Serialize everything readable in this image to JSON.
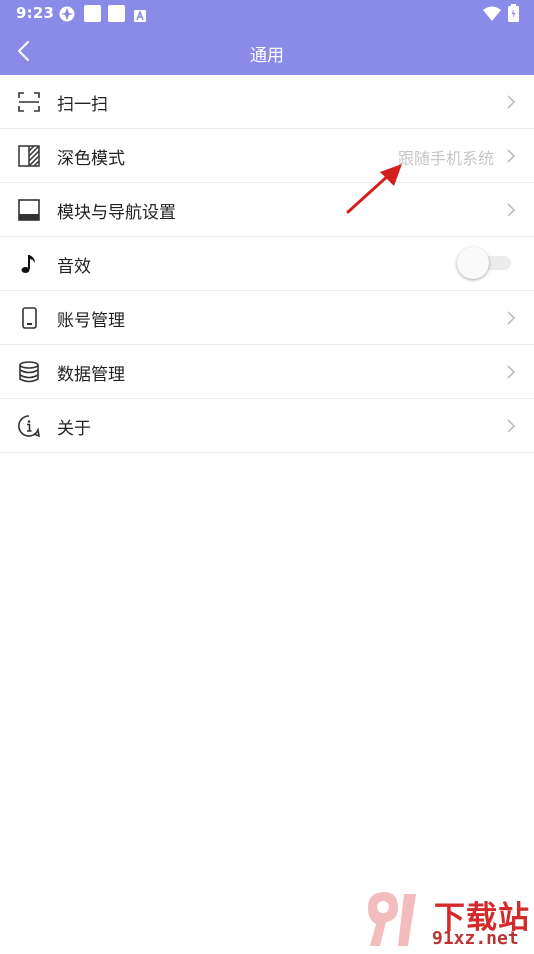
{
  "status_bar": {
    "time": "9:23"
  },
  "app_bar": {
    "title": "通用",
    "back_icon": "chevron-left-icon"
  },
  "settings": {
    "items": [
      {
        "label": "扫一扫",
        "icon": "scan-icon"
      },
      {
        "label": "深色模式",
        "value": "跟随手机系统",
        "icon": "dark-mode-icon"
      },
      {
        "label": "模块与导航设置",
        "icon": "tablet-layout-icon"
      },
      {
        "label": "音效",
        "icon": "music-note-icon",
        "toggle_on": false
      },
      {
        "label": "账号管理",
        "icon": "phone-icon"
      },
      {
        "label": "数据管理",
        "icon": "database-icon"
      },
      {
        "label": "关于",
        "icon": "info-icon"
      }
    ]
  },
  "watermark": {
    "text": "下载站",
    "url": "91xz.net"
  },
  "colors": {
    "app_bar": "#8a8ae8",
    "annotation_arrow": "#d41f1f",
    "value_text": "#c6c6c6"
  }
}
